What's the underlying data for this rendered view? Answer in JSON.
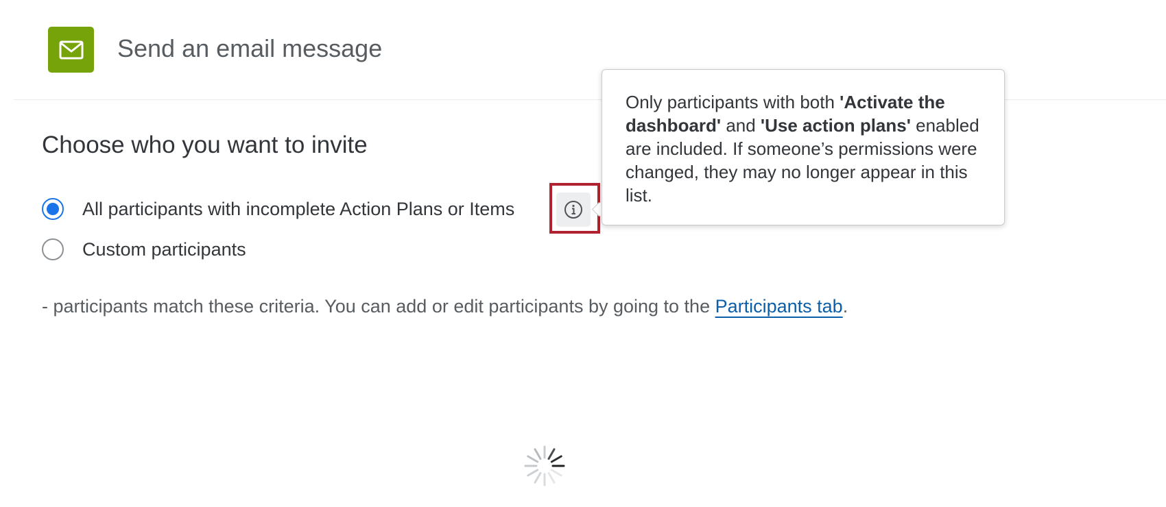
{
  "header": {
    "icon": "envelope-icon",
    "icon_color": "#76a30a",
    "title": "Send an email message"
  },
  "section": {
    "title": "Choose who you want to invite"
  },
  "options": [
    {
      "label": "All participants with incomplete Action Plans or Items",
      "selected": true
    },
    {
      "label": "Custom participants",
      "selected": false
    }
  ],
  "info_icon": "info-icon",
  "tooltip": {
    "part1": "Only participants with both ",
    "bold1": "'Activate the dashboard'",
    "part2": " and ",
    "bold2": "'Use action plans'",
    "part3": " enabled are included. If someone’s permissions were changed, they may no longer appear in this list."
  },
  "criteria": {
    "count": "-",
    "text": " participants match these criteria. You can add or edit participants by going to the ",
    "link_label": "Participants tab",
    "end": "."
  },
  "colors": {
    "accent_blue": "#1a73e8",
    "link": "#0b5ea8",
    "highlight_border": "#b0222e"
  },
  "loading_indicator": "spinner-icon"
}
